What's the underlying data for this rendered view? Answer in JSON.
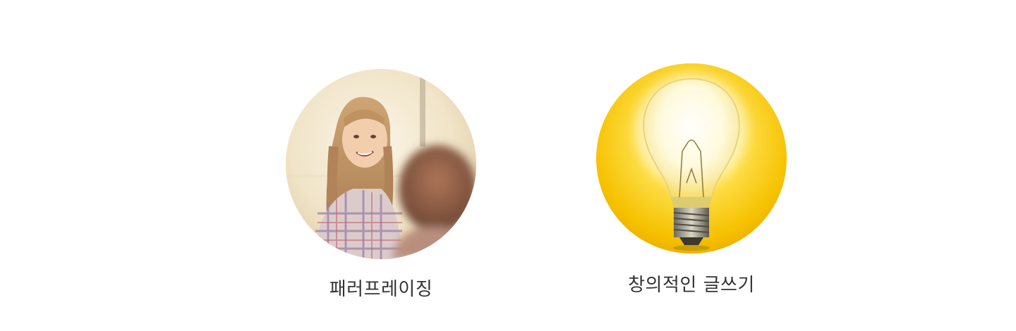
{
  "features": [
    {
      "label": "패러프레이징",
      "image": "girl-smiling-classroom-photo"
    },
    {
      "label": "창의적인 글쓰기",
      "image": "glowing-light-bulb-icon"
    }
  ],
  "colors": {
    "bulb_bg_outer": "#f2b800",
    "bulb_bg_inner": "#ffe55a",
    "text": "#333333"
  }
}
